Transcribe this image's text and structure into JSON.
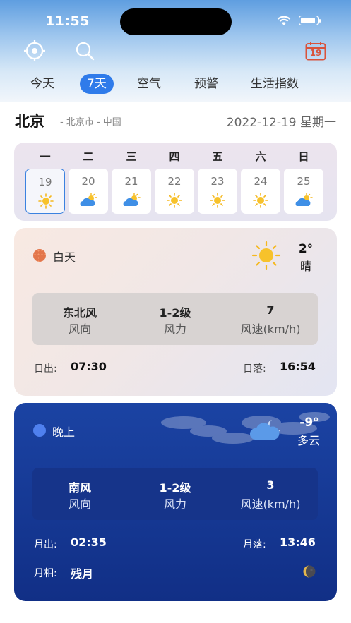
{
  "status_bar": {
    "time": "11:55"
  },
  "toolbar": {
    "locate_icon": "crosshair-icon",
    "search_icon": "search-icon",
    "calendar_icon": "calendar-icon",
    "calendar_day": "19"
  },
  "tabs": [
    "今天",
    "7天",
    "空气",
    "预警",
    "生活指数"
  ],
  "active_tab": "7天",
  "location": {
    "city": "北京",
    "region": "- 北京市 - 中国",
    "date": "2022-12-19 星期一"
  },
  "week": [
    {
      "weekday": "一",
      "day": "19",
      "icon": "sunny-icon",
      "selected": true
    },
    {
      "weekday": "二",
      "day": "20",
      "icon": "cloudy-sun-icon",
      "selected": false
    },
    {
      "weekday": "三",
      "day": "21",
      "icon": "cloudy-sun-icon",
      "selected": false
    },
    {
      "weekday": "四",
      "day": "22",
      "icon": "sunny-icon",
      "selected": false
    },
    {
      "weekday": "五",
      "day": "23",
      "icon": "sunny-icon",
      "selected": false
    },
    {
      "weekday": "六",
      "day": "24",
      "icon": "sunny-icon",
      "selected": false
    },
    {
      "weekday": "日",
      "day": "25",
      "icon": "cloudy-sun-icon",
      "selected": false
    }
  ],
  "day": {
    "label": "白天",
    "temp": "2°",
    "condition": "晴",
    "wind_dir": "东北风",
    "wind_dir_label": "风向",
    "wind_force": "1-2级",
    "wind_force_label": "风力",
    "wind_speed": "7",
    "wind_speed_label": "风速(km/h)",
    "sunrise_label": "日出:",
    "sunrise": "07:30",
    "sunset_label": "日落:",
    "sunset": "16:54",
    "colors": {
      "dot": "#e3764b",
      "accent": "#f5b820"
    }
  },
  "night": {
    "label": "晚上",
    "temp": "-9°",
    "condition": "多云",
    "wind_dir": "南风",
    "wind_dir_label": "风向",
    "wind_force": "1-2级",
    "wind_force_label": "风力",
    "wind_speed": "3",
    "wind_speed_label": "风速(km/h)",
    "moonrise_label": "月出:",
    "moonrise": "02:35",
    "moonset_label": "月落:",
    "moonset": "13:46",
    "phase_label": "月相:",
    "phase": "残月",
    "colors": {
      "dot": "#4f80ee",
      "card": "#17399a"
    }
  }
}
